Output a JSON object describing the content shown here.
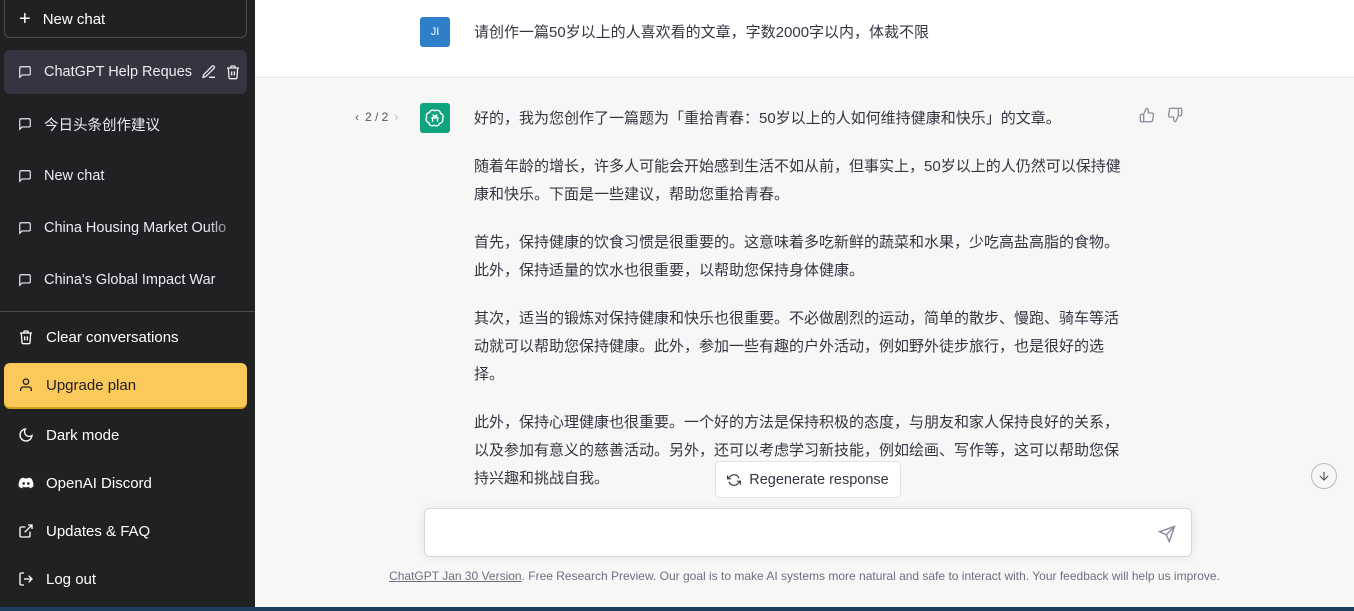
{
  "sidebar": {
    "new_chat": "New chat",
    "conversations": [
      {
        "label": "ChatGPT Help Reques",
        "active": true
      },
      {
        "label": "今日头条创作建议"
      },
      {
        "label": "New chat"
      },
      {
        "label": "China Housing Market Outlo"
      },
      {
        "label": "China's Global Impact War"
      }
    ],
    "menu": {
      "clear": "Clear conversations",
      "upgrade": "Upgrade plan",
      "dark": "Dark mode",
      "discord": "OpenAI Discord",
      "updates": "Updates & FAQ",
      "logout": "Log out"
    }
  },
  "user": {
    "avatar": "JI",
    "message": "请创作一篇50岁以上的人喜欢看的文章，字数2000字以内，体裁不限"
  },
  "response": {
    "pager": {
      "prev": "‹",
      "current": "2 / 2",
      "next": "›"
    },
    "paragraphs": [
      "好的，我为您创作了一篇题为「重拾青春：50岁以上的人如何维持健康和快乐」的文章。",
      "随着年龄的增长，许多人可能会开始感到生活不如从前，但事实上，50岁以上的人仍然可以保持健康和快乐。下面是一些建议，帮助您重拾青春。",
      "首先，保持健康的饮食习惯是很重要的。这意味着多吃新鲜的蔬菜和水果，少吃高盐高脂的食物。此外，保持适量的饮水也很重要，以帮助您保持身体健康。",
      "其次，适当的锻炼对保持健康和快乐也很重要。不必做剧烈的运动，简单的散步、慢跑、骑车等活动就可以帮助您保持健康。此外，参加一些有趣的户外活动，例如野外徒步旅行，也是很好的选择。",
      "此外，保持心理健康也很重要。一个好的方法是保持积极的态度，与朋友和家人保持良好的关系，以及参加有意义的慈善活动。另外，还可以考虑学习新技能，例如绘画、写作等，这可以帮助您保持兴趣和挑战自我。"
    ]
  },
  "regenerate": "Regenerate response",
  "input": {
    "placeholder": ""
  },
  "footer": {
    "link": "ChatGPT Jan 30 Version",
    "text": ". Free Research Preview. Our goal is to make AI systems more natural and safe to interact with. Your feedback will help us improve."
  },
  "colors": {
    "sidebar": "#202123",
    "upgrade": "#fbc85a",
    "ai_avatar": "#10a37f",
    "user_avatar": "#2e7fc8"
  }
}
